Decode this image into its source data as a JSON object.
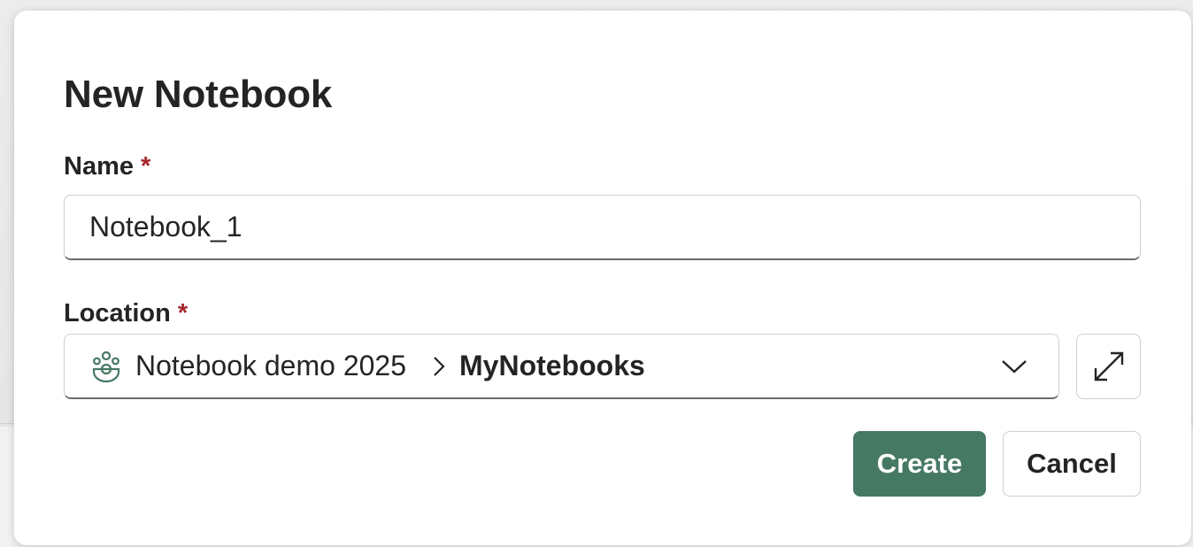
{
  "dialog": {
    "title": "New Notebook",
    "name_field": {
      "label": "Name",
      "required_mark": "*",
      "value": "Notebook_1"
    },
    "location_field": {
      "label": "Location",
      "required_mark": "*",
      "workspace": "Notebook demo 2025",
      "folder": "MyNotebooks",
      "workspace_icon": "workspace-icon",
      "separator_icon": "chevron-right-icon",
      "dropdown_icon": "chevron-down-icon"
    },
    "expand_button_icon": "expand-icon",
    "buttons": {
      "create": "Create",
      "cancel": "Cancel"
    }
  },
  "colors": {
    "primary": "#467964",
    "required": "#a4262c",
    "text": "#242424"
  }
}
